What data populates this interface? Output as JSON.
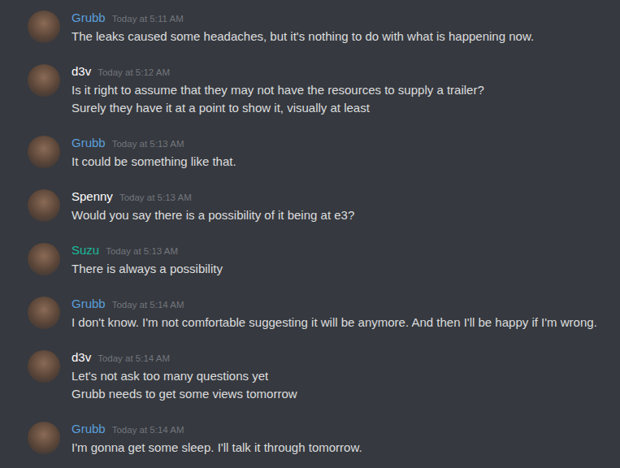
{
  "messages": [
    {
      "author": "Grubb",
      "color": "#5a9fdc",
      "timestamp": "Today at 5:11 AM",
      "lines": [
        "The leaks caused some headaches, but it's nothing to do with what is happening now."
      ]
    },
    {
      "author": "d3v",
      "color": "#ffffff",
      "timestamp": "Today at 5:12 AM",
      "lines": [
        "Is it right to assume that they may not have the resources to supply a trailer?",
        "Surely they have it at a point to show it, visually at least"
      ]
    },
    {
      "author": "Grubb",
      "color": "#5a9fdc",
      "timestamp": "Today at 5:13 AM",
      "lines": [
        "It could be something like that."
      ]
    },
    {
      "author": "Spenny",
      "color": "#ffffff",
      "timestamp": "Today at 5:13 AM",
      "lines": [
        "Would you say there is a possibility of it being at e3?"
      ]
    },
    {
      "author": "Suzu",
      "color": "#1abc9c",
      "timestamp": "Today at 5:13 AM",
      "lines": [
        "There is always a possibility"
      ]
    },
    {
      "author": "Grubb",
      "color": "#5a9fdc",
      "timestamp": "Today at 5:14 AM",
      "lines": [
        "I don't know. I'm not comfortable suggesting it will be anymore. And then I'll be happy if I'm wrong."
      ]
    },
    {
      "author": "d3v",
      "color": "#ffffff",
      "timestamp": "Today at 5:14 AM",
      "lines": [
        "Let's not ask too many questions yet",
        "Grubb needs to get some views tomorrow"
      ]
    },
    {
      "author": "Grubb",
      "color": "#5a9fdc",
      "timestamp": "Today at 5:14 AM",
      "lines": [
        "I'm gonna get some sleep. I'll talk it through tomorrow."
      ]
    }
  ]
}
